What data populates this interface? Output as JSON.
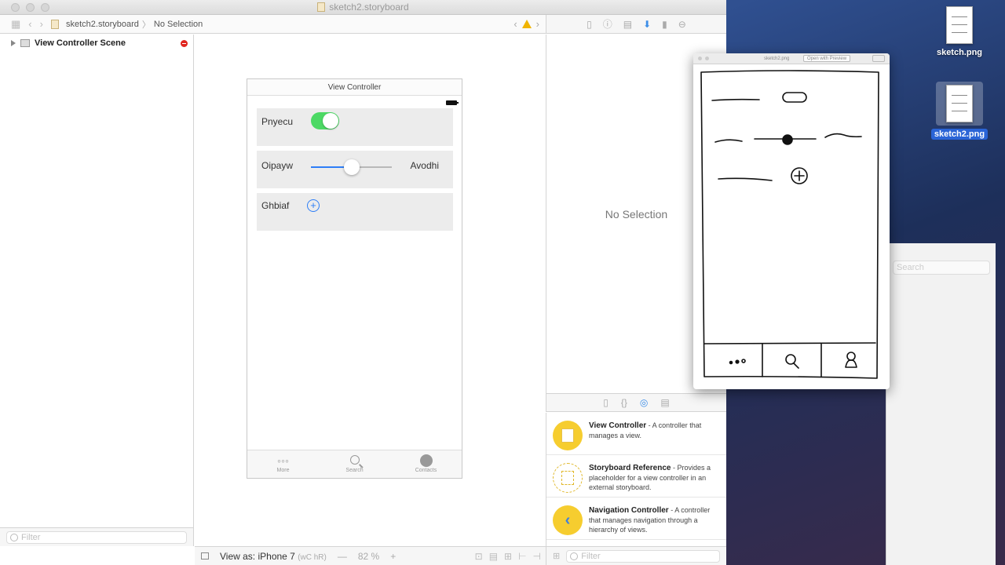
{
  "window": {
    "title": "sketch2.storyboard"
  },
  "jumpbar": {
    "file": "sketch2.storyboard",
    "selection": "No Selection"
  },
  "outline": {
    "scene_label": "View Controller Scene",
    "filter_placeholder": "Filter"
  },
  "scene": {
    "title": "View Controller",
    "row1_label": "Pnyecu",
    "row2_label": "Oipayw",
    "row2_value_label": "Avodhi",
    "row3_label": "Ghbiaf",
    "switch_on": true,
    "slider_value": 0.5,
    "tabs": [
      "More",
      "Search",
      "Contacts"
    ]
  },
  "canvas_bottom": {
    "view_as": "View as: iPhone 7",
    "size_class": "(wC hR)",
    "zoom_minus": "—",
    "zoom": "82 %",
    "zoom_plus": "+"
  },
  "inspector": {
    "empty_text": "No Selection"
  },
  "library": {
    "items": [
      {
        "name": "View Controller",
        "desc": " - A controller that manages a view."
      },
      {
        "name": "Storyboard Reference",
        "desc": " - Provides a placeholder for a view controller in an external storyboard."
      },
      {
        "name": "Navigation Controller",
        "desc": " - A controller that manages navigation through a hierarchy of views."
      }
    ],
    "filter_placeholder": "Filter"
  },
  "preview": {
    "filename": "sketch2.png",
    "open_button": "Open with Preview"
  },
  "desktop": {
    "file1": "sketch.png",
    "file2": "sketch2.png",
    "search_placeholder": "Search"
  },
  "colors": {
    "accent": "#2d7ef7",
    "switch_on": "#4cd964",
    "library_yellow": "#f6cd2f",
    "error_red": "#e0241e"
  }
}
